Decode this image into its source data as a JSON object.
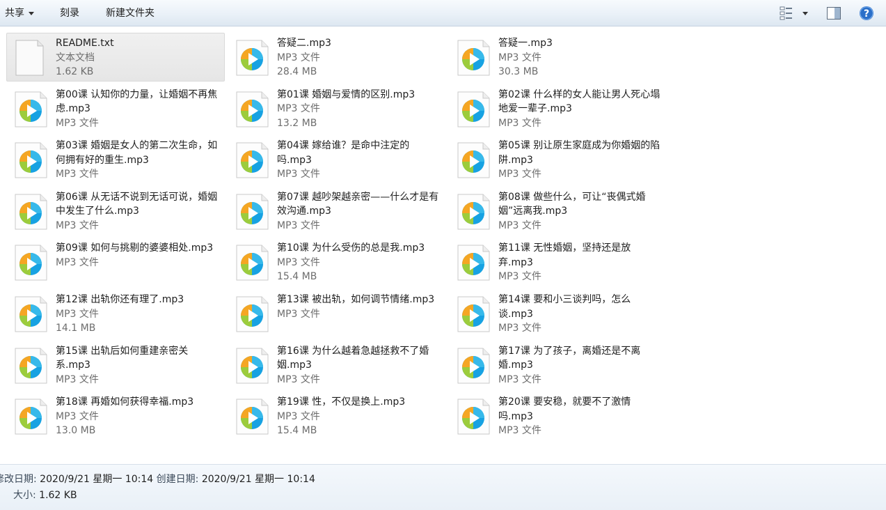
{
  "toolbar": {
    "share_label": "共享",
    "burn_label": "刻录",
    "new_folder_label": "新建文件夹",
    "view_icon": "view-options-icon",
    "preview_icon": "preview-pane-icon",
    "help_icon": "help-icon"
  },
  "files": [
    {
      "name": "README.txt",
      "type": "文本文档",
      "size": "1.62 KB",
      "icon": "text-file-icon",
      "selected": true
    },
    {
      "name": "答疑二.mp3",
      "type": "MP3 文件",
      "size": "28.4 MB",
      "icon": "media-play-icon"
    },
    {
      "name": "答疑一.mp3",
      "type": "MP3 文件",
      "size": "30.3 MB",
      "icon": "media-play-icon"
    },
    {
      "name": "第00课 认知你的力量，让婚姻不再焦虑.mp3",
      "type": "MP3 文件",
      "size": "",
      "icon": "media-play-icon"
    },
    {
      "name": "第01课 婚姻与爱情的区别.mp3",
      "type": "MP3 文件",
      "size": "13.2 MB",
      "icon": "media-play-icon"
    },
    {
      "name": "第02课 什么样的女人能让男人死心塌地爱一辈子.mp3",
      "type": "MP3 文件",
      "size": "",
      "icon": "media-play-icon"
    },
    {
      "name": "第03课 婚姻是女人的第二次生命，如何拥有好的重生.mp3",
      "type": "MP3 文件",
      "size": "",
      "icon": "media-play-icon"
    },
    {
      "name": "第04课 嫁给谁？是命中注定的吗.mp3",
      "type": "MP3 文件",
      "size": "",
      "icon": "media-play-icon"
    },
    {
      "name": "第05课 别让原生家庭成为你婚姻的陷阱.mp3",
      "type": "MP3 文件",
      "size": "",
      "icon": "media-play-icon"
    },
    {
      "name": "第06课 从无话不说到无话可说，婚姻中发生了什么.mp3",
      "type": "MP3 文件",
      "size": "",
      "icon": "media-play-icon"
    },
    {
      "name": "第07课 越吵架越亲密——什么才是有效沟通.mp3",
      "type": "MP3 文件",
      "size": "",
      "icon": "media-play-icon"
    },
    {
      "name": "第08课 做些什么，可让“丧偶式婚姻”远离我.mp3",
      "type": "MP3 文件",
      "size": "",
      "icon": "media-play-icon"
    },
    {
      "name": "第09课 如何与挑剔的婆婆相处.mp3",
      "type": "MP3 文件",
      "size": "",
      "icon": "media-play-icon"
    },
    {
      "name": "第10课 为什么受伤的总是我.mp3",
      "type": "MP3 文件",
      "size": "15.4 MB",
      "icon": "media-play-icon"
    },
    {
      "name": "第11课 无性婚姻，坚持还是放弃.mp3",
      "type": "MP3 文件",
      "size": "",
      "icon": "media-play-icon"
    },
    {
      "name": "第12课 出轨你还有理了.mp3",
      "type": "MP3 文件",
      "size": "14.1 MB",
      "icon": "media-play-icon"
    },
    {
      "name": "第13课 被出轨，如何调节情绪.mp3",
      "type": "MP3 文件",
      "size": "",
      "icon": "media-play-icon"
    },
    {
      "name": "第14课 要和小三谈判吗，怎么谈.mp3",
      "type": "MP3 文件",
      "size": "",
      "icon": "media-play-icon"
    },
    {
      "name": "第15课 出轨后如何重建亲密关系.mp3",
      "type": "MP3 文件",
      "size": "",
      "icon": "media-play-icon"
    },
    {
      "name": "第16课 为什么越着急越拯救不了婚姻.mp3",
      "type": "MP3 文件",
      "size": "",
      "icon": "media-play-icon"
    },
    {
      "name": "第17课 为了孩子，离婚还是不离婚.mp3",
      "type": "MP3 文件",
      "size": "",
      "icon": "media-play-icon"
    },
    {
      "name": "第18课 再婚如何获得幸福.mp3",
      "type": "MP3 文件",
      "size": "13.0 MB",
      "icon": "media-play-icon"
    },
    {
      "name": "第19课 性，不仅是换上.mp3",
      "type": "MP3 文件",
      "size": "15.4 MB",
      "icon": "media-play-icon"
    },
    {
      "name": "第20课 要安稳，就要不了激情吗.mp3",
      "type": "MP3 文件",
      "size": "",
      "icon": "media-play-icon"
    }
  ],
  "details": {
    "modified_label": "修改日期:",
    "modified_value": "2020/9/21 星期一 10:14",
    "created_label": "创建日期:",
    "created_value": "2020/9/21 星期一 10:14",
    "size_label": "大小:",
    "size_value": "1.62 KB"
  },
  "colors": {
    "toolbar_top": "#f7fafd",
    "toolbar_bottom": "#dde7f1",
    "meta_text": "#6d6d6d",
    "help_blue": "#2a6fc9"
  }
}
